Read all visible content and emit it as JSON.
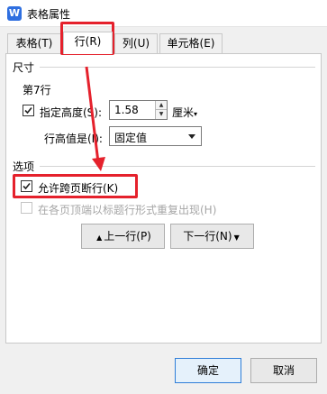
{
  "window": {
    "title": "表格属性",
    "icon": "wps-writer-icon"
  },
  "tabs": [
    {
      "label": "表格(T)",
      "active": false
    },
    {
      "label": "行(R)",
      "active": true
    },
    {
      "label": "列(U)",
      "active": false
    },
    {
      "label": "单元格(E)",
      "active": false
    }
  ],
  "size_section": {
    "title": "尺寸",
    "row_label": "第7行",
    "specify_height": {
      "label": "指定高度(S):",
      "checked": true
    },
    "height": {
      "value": "1.58",
      "unit": "厘米"
    },
    "row_height_is": {
      "label": "行高值是(I):",
      "value": "固定值"
    }
  },
  "options_section": {
    "title": "选项",
    "allow_break": {
      "label": "允许跨页断行(K)",
      "checked": true
    },
    "repeat_header": {
      "label": "在各页顶端以标题行形式重复出现(H)",
      "checked": false,
      "disabled": true
    }
  },
  "nav": {
    "prev_label": "上一行(P)",
    "next_label": "下一行(N)"
  },
  "footer": {
    "ok_label": "确定",
    "cancel_label": "取消"
  },
  "colors": {
    "highlight": "#e5212c",
    "accent": "#2f7ed8"
  }
}
